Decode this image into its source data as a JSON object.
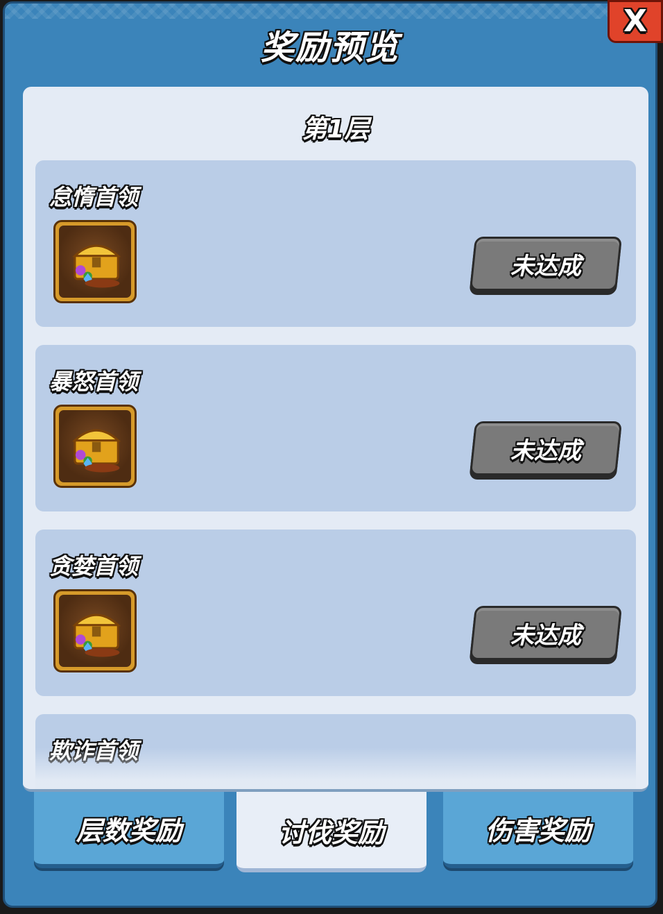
{
  "dialog": {
    "title": "奖励预览",
    "close_label": "X"
  },
  "content": {
    "floor_label": "第1层",
    "bosses": [
      {
        "name": "怠惰首领",
        "reward_icon": "treasure-chest-icon",
        "status": "未达成"
      },
      {
        "name": "暴怒首领",
        "reward_icon": "treasure-chest-icon",
        "status": "未达成"
      },
      {
        "name": "贪婪首领",
        "reward_icon": "treasure-chest-icon",
        "status": "未达成"
      },
      {
        "name": "欺诈首领"
      }
    ]
  },
  "tabs": [
    {
      "label": "层数奖励",
      "active": false
    },
    {
      "label": "讨伐奖励",
      "active": true
    },
    {
      "label": "伤害奖励",
      "active": false
    }
  ],
  "colors": {
    "panel_blue": "#3b84ba",
    "card_blue": "#bacde7",
    "close_red": "#e0432a",
    "status_gray": "#7a7a7a",
    "icon_frame_gold": "#d69a2a"
  }
}
